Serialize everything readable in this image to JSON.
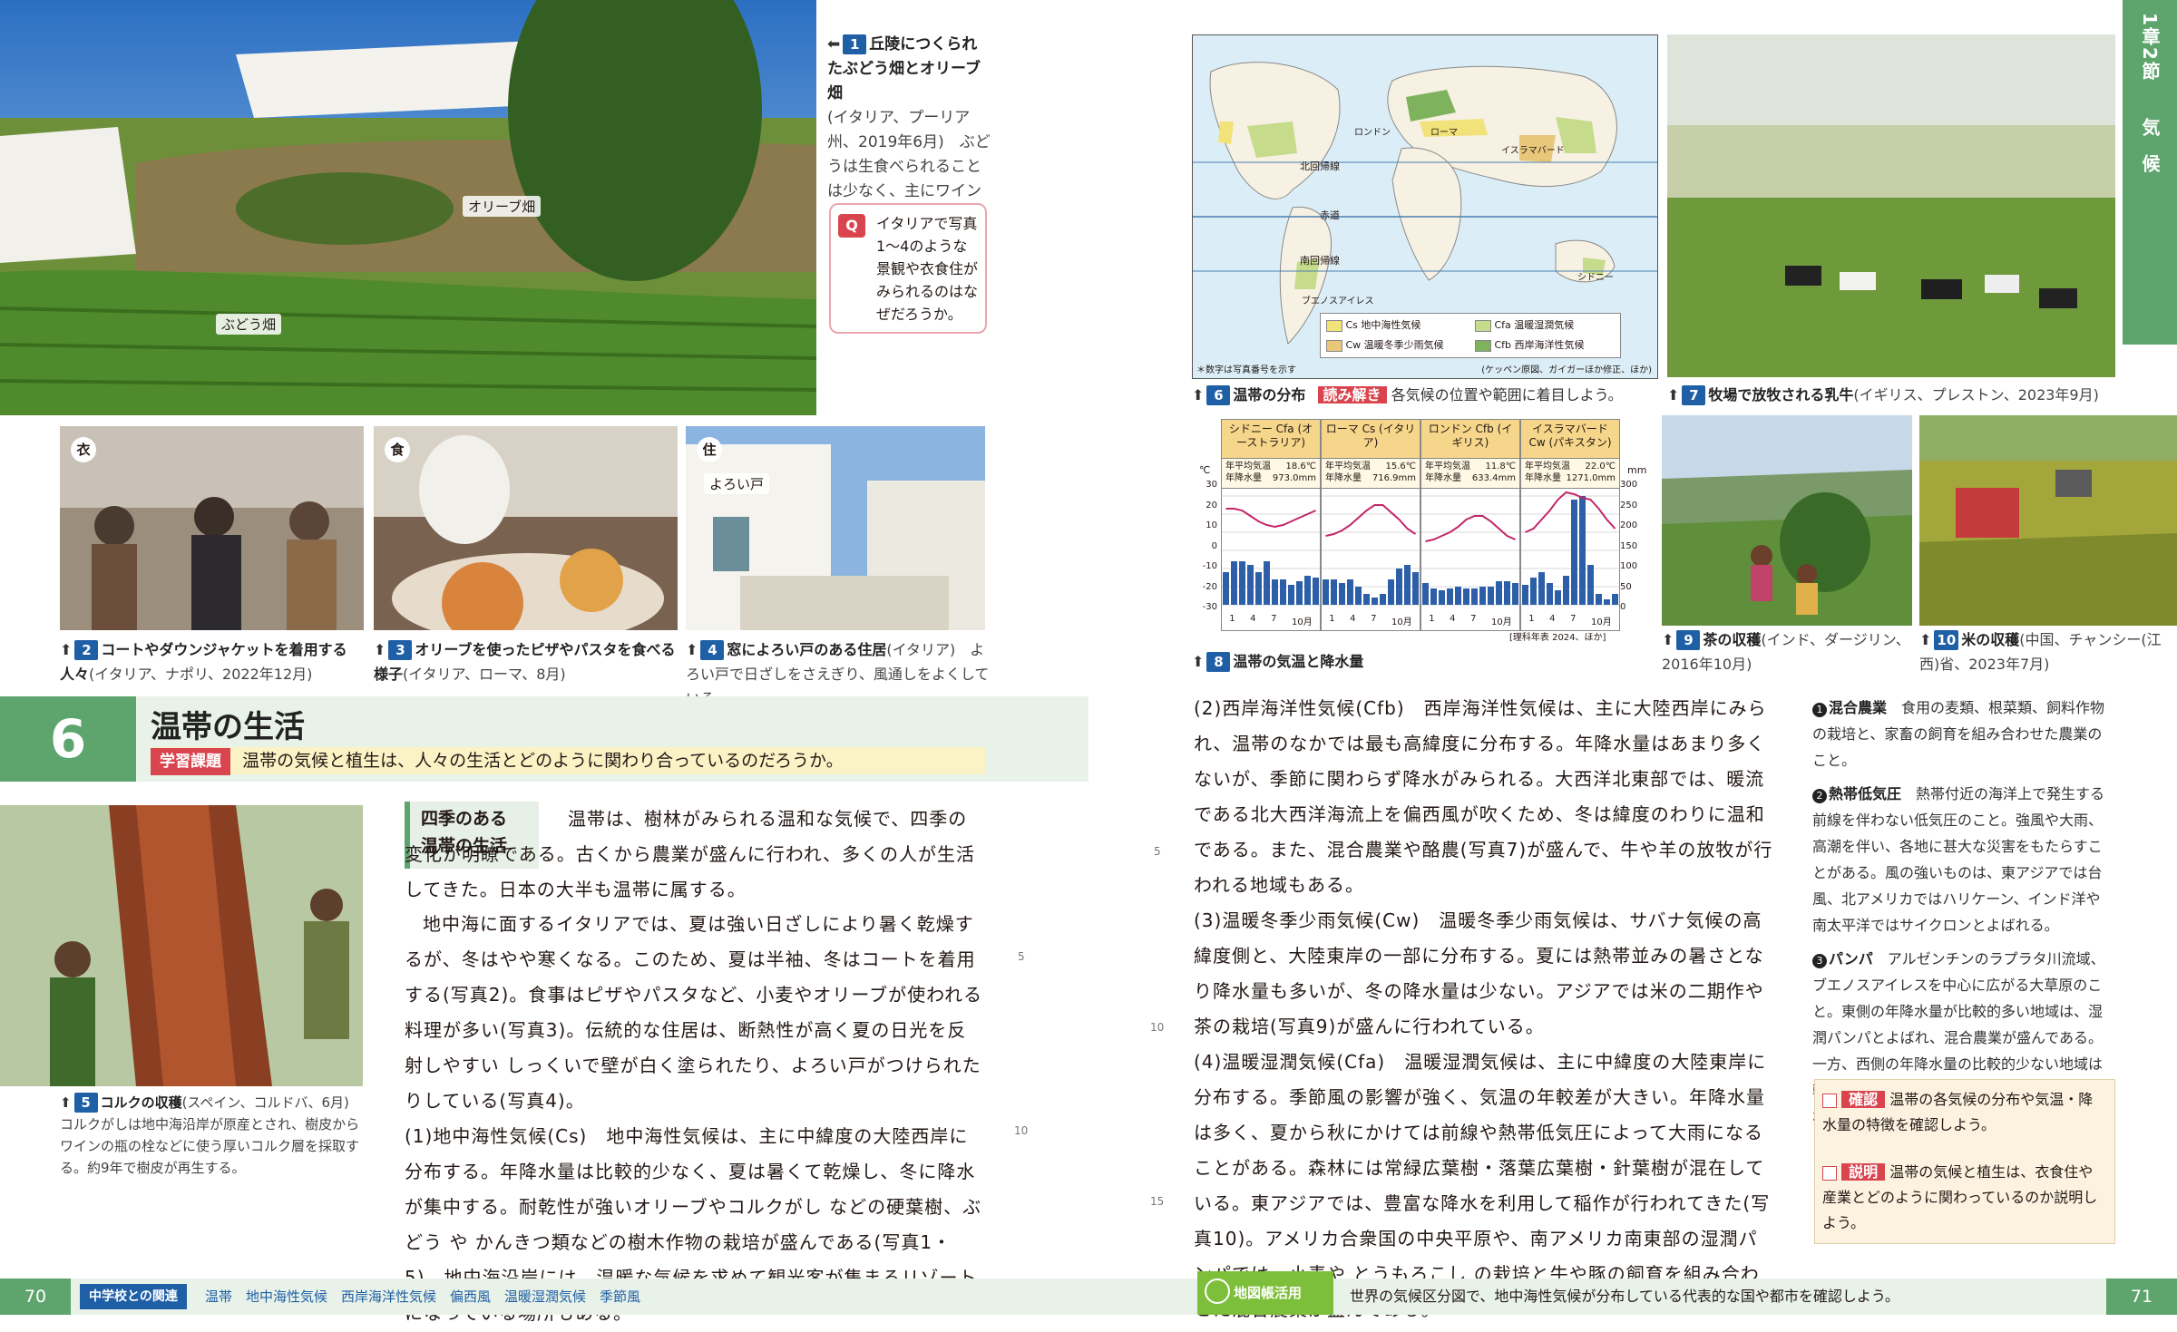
{
  "left_page": {
    "hero_photo": {
      "labels": {
        "olive": "オリーブ畑",
        "vineyard": "ぶどう畑"
      },
      "caption_title": "丘陵につくられたぶどう畑とオリーブ畑",
      "caption_num": "1",
      "caption_body": "(イタリア、プーリア州、2019年6月)　ぶどうは生食べられることは少なく、主にワインに加工される。"
    },
    "question": {
      "label": "Q",
      "text": "イタリアで写真1〜4のような景観や衣食住がみられるのはなぜだろうか。"
    },
    "small_photos": [
      {
        "tag": "衣",
        "num": "2",
        "title": "コートやダウンジャケットを着用する人々",
        "sub": "(イタリア、ナポリ、2022年12月)"
      },
      {
        "tag": "食",
        "num": "3",
        "title": "オリーブを使ったピザやパスタを食べる様子",
        "sub": "(イタリア、ローマ、8月)"
      },
      {
        "tag": "住",
        "num": "4",
        "title": "窓によろい戸のある住居",
        "sub": "(イタリア)　よろい戸で日ざしをさえぎり、風通しをよくしている。",
        "label": "よろい戸"
      }
    ],
    "section": {
      "number": "6",
      "title": "温帯の生活",
      "task_label": "学習課題",
      "task_text": "温帯の気候と植生は、人々の生活とどのように関わり合っているのだろうか。"
    },
    "cork_photo": {
      "num": "5",
      "title": "コルクの収穫",
      "sub": "(スペイン、コルドバ、6月)　コルクがしは地中海沿岸が原産とされ、樹皮からワインの瓶の栓などに使う厚いコルク層を採取する。約9年で樹皮が再生する。"
    },
    "subhead": [
      "四季のある",
      "温帯の生活"
    ],
    "paragraphs": [
      "温帯は、樹林がみられる温和な気候で、四季の変化が明瞭である。古くから農業が盛んに行われ、多くの人が生活してきた。日本の大半も温帯に属する。",
      "地中海に面するイタリアでは、夏は強い日ざしにより暑く乾燥するが、冬はやや寒くなる。このため、夏は半袖、冬はコートを着用する(写真2)。食事はピザやパスタなど、小麦やオリーブが使われる料理が多い(写真3)。伝統的な住居は、断熱性が高く夏の日光を反射しやすい しっくいで壁が白く塗られたり、よろい戸がつけられたりしている(写真4)。",
      "(1)地中海性気候(Cs)　地中海性気候は、主に中緯度の大陸西岸に分布する。年降水量は比較的少なく、夏は暑くて乾燥し、冬に降水が集中する。耐乾性が強いオリーブやコルクがし などの硬葉樹、ぶどう や かんきつ類などの樹木作物の栽培が盛んである(写真1・5)。地中海沿岸には、温暖な気候を求めて観光客が集まるリゾートになっている場所もある。"
    ],
    "line_numbers": [
      "5",
      "10"
    ],
    "footer": {
      "page": "70",
      "tag": "中学校との関連",
      "terms": "温帯　地中海性気候　西岸海洋性気候　偏西風　温暖湿潤気候　季節風"
    }
  },
  "right_page": {
    "map": {
      "labels": [
        "北回帰線",
        "赤道",
        "南回帰線",
        "ロンドン",
        "ローマ",
        "イスラマバード",
        "シドニー",
        "ブエノスアイレス"
      ],
      "legend": [
        "Cs 地中海性気候",
        "Cfa 温暖湿潤気候",
        "Cw 温暖冬季少雨気候",
        "Cfb 西岸海洋性気候"
      ],
      "legend_colors": [
        "#f2e27a",
        "#c6dc8c",
        "#e8c77a",
        "#7fb25c"
      ],
      "note": "＊数字は写真番号を示す",
      "source": "(ケッペン原図、ガイガーほか修正、ほか)",
      "num": "6",
      "title": "温帯の分布",
      "read_label": "読み解き",
      "read_text": "各気候の位置や範囲に着目しよう。"
    },
    "cows_photo": {
      "num": "7",
      "title": "牧場で放牧される乳牛",
      "sub": "(イギリス、プレストン、2023年9月)"
    },
    "climate_chart": {
      "num": "8",
      "title": "温帯の気温と降水量",
      "source": "[理科年表 2024、ほか]",
      "left_unit": "℃",
      "right_unit": "mm",
      "left_ticks": [
        "30",
        "20",
        "10",
        "0",
        "-10",
        "-20",
        "-30"
      ],
      "right_ticks": [
        "300",
        "250",
        "200",
        "150",
        "100",
        "50",
        "0"
      ],
      "months": [
        "1",
        "4",
        "7",
        "10月"
      ]
    },
    "chart_data": [
      {
        "type": "bar",
        "title": "シドニー Cfa (オーストラリア)",
        "temp_label": "年平均気温",
        "temp": "18.6℃",
        "prec_label": "年降水量",
        "prec": "973.0mm",
        "categories": [
          "1",
          "2",
          "3",
          "4",
          "5",
          "6",
          "7",
          "8",
          "9",
          "10",
          "11",
          "12"
        ],
        "series": [
          {
            "name": "降水量",
            "values": [
              90,
              120,
              120,
              110,
              90,
              120,
              70,
              70,
              55,
              65,
              80,
              75
            ]
          },
          {
            "name": "気温",
            "values": [
              23,
              23,
              22,
              19,
              16,
              14,
              13,
              14,
              16,
              18,
              20,
              22
            ]
          }
        ]
      },
      {
        "type": "bar",
        "title": "ローマ Cs (イタリア)",
        "temp_label": "年平均気温",
        "temp": "15.6℃",
        "prec_label": "年降水量",
        "prec": "716.9mm",
        "categories": [
          "1",
          "2",
          "3",
          "4",
          "5",
          "6",
          "7",
          "8",
          "9",
          "10",
          "11",
          "12"
        ],
        "series": [
          {
            "name": "降水量",
            "values": [
              70,
              70,
              60,
              70,
              50,
              30,
              20,
              30,
              70,
              100,
              110,
              90
            ]
          },
          {
            "name": "気温",
            "values": [
              8,
              9,
              11,
              14,
              18,
              22,
              25,
              25,
              21,
              17,
              12,
              9
            ]
          }
        ]
      },
      {
        "type": "bar",
        "title": "ロンドン Cfb (イギリス)",
        "temp_label": "年平均気温",
        "temp": "11.8℃",
        "prec_label": "年降水量",
        "prec": "633.4mm",
        "categories": [
          "1",
          "2",
          "3",
          "4",
          "5",
          "6",
          "7",
          "8",
          "9",
          "10",
          "11",
          "12"
        ],
        "series": [
          {
            "name": "降水量",
            "values": [
              60,
              45,
              40,
              45,
              50,
              45,
              45,
              50,
              50,
              65,
              65,
              60
            ]
          },
          {
            "name": "気温",
            "values": [
              5,
              6,
              8,
              10,
              13,
              17,
              19,
              19,
              16,
              12,
              8,
              6
            ]
          }
        ]
      },
      {
        "type": "bar",
        "title": "イスラマバード Cw (パキスタン)",
        "temp_label": "年平均気温",
        "temp": "22.0℃",
        "prec_label": "年降水量",
        "prec": "1271.0mm",
        "categories": [
          "1",
          "2",
          "3",
          "4",
          "5",
          "6",
          "7",
          "8",
          "9",
          "10",
          "11",
          "12"
        ],
        "series": [
          {
            "name": "降水量",
            "values": [
              55,
              75,
              90,
              60,
              40,
              80,
              290,
              300,
              110,
              30,
              15,
              30
            ]
          },
          {
            "name": "気温",
            "values": [
              10,
              12,
              17,
              22,
              28,
              32,
              31,
              29,
              28,
              23,
              17,
              12
            ]
          }
        ]
      }
    ],
    "tea_photo": {
      "num": "9",
      "title": "茶の収穫",
      "sub": "(インド、ダージリン、2016年10月)"
    },
    "rice_photo": {
      "num": "10",
      "title": "米の収穫",
      "sub": "(中国、チャンシー(江西)省、2023年7月)"
    },
    "paragraphs": [
      "(2)西岸海洋性気候(Cfb)　西岸海洋性気候は、主に大陸西岸にみられ、温帯のなかでは最も高緯度に分布する。年降水量はあまり多くないが、季節に関わらず降水がみられる。大西洋北東部では、暖流である北大西洋海流上を偏西風が吹くため、冬は緯度のわりに温和である。また、混合農業や酪農(写真7)が盛んで、牛や羊の放牧が行われる地域もある。",
      "(3)温暖冬季少雨気候(Cw)　温暖冬季少雨気候は、サバナ気候の高緯度側と、大陸東岸の一部に分布する。夏には熱帯並みの暑さとなり降水量も多いが、冬の降水量は少ない。アジアでは米の二期作や茶の栽培(写真9)が盛んに行われている。",
      "(4)温暖湿潤気候(Cfa)　温暖湿潤気候は、主に中緯度の大陸東岸に分布する。季節風の影響が強く、気温の年較差が大きい。年降水量は多く、夏から秋にかけては前線や熱帯低気圧によって大雨になることがある。森林には常緑広葉樹・落葉広葉樹・針葉樹が混在している。東アジアでは、豊富な降水を利用して稲作が行われてきた(写真10)。アメリカ合衆国の中央平原や、南アメリカ南東部の湿潤パンパでは、小麦や とうもろこし の栽培と牛や豚の飼育を組み合わせた混合農業が盛んである。"
    ],
    "line_numbers": [
      "5",
      "10",
      "15"
    ],
    "notes": [
      {
        "mark": "1",
        "term": "混合農業",
        "text": "食用の麦類、根菜類、飼料作物の栽培と、家畜の飼育を組み合わせた農業のこと。"
      },
      {
        "mark": "2",
        "term": "熱帯低気圧",
        "text": "熱帯付近の海洋上で発生する前線を伴わない低気圧のこと。強風や大雨、高潮を伴い、各地に甚大な災害をもたらすことがある。風の強いものは、東アジアでは台風、北アメリカではハリケーン、インド洋や南太平洋ではサイクロンとよばれる。"
      },
      {
        "mark": "3",
        "term": "パンパ",
        "text": "アルゼンチンのラプラタ川流域、ブエノスアイレスを中心に広がる大草原のこと。東側の年降水量が比較的多い地域は、湿潤パンパとよばれ、混合農業が盛んである。一方、西側の年降水量の比較的少ない地域は乾燥パンパとよばれ、ステップで牧羊が行われている。"
      }
    ],
    "check": {
      "label": "確認",
      "text": "温帯の各気候の分布や気温・降水量の特徴を確認しよう。"
    },
    "explain": {
      "label": "説明",
      "text": "温帯の気候と植生は、衣食住や産業とどのように関わっているのか説明しよう。"
    },
    "side_tab": {
      "chapter": "1章2節",
      "topic": "気候"
    },
    "footer": {
      "page": "71",
      "tag": "地図帳活用",
      "text": "世界の気候区分図で、地中海性気候が分布している代表的な国や都市を確認しよう。"
    }
  }
}
